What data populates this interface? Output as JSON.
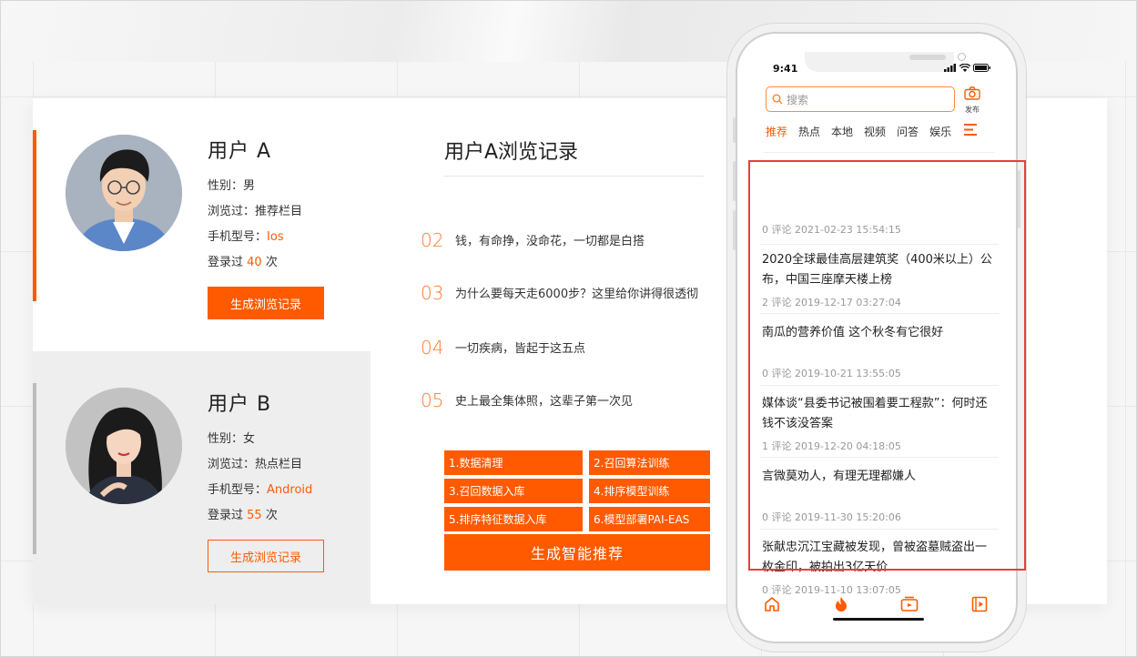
{
  "colors": {
    "accent": "#ff5a00",
    "highlight": "#e0433b",
    "muted": "#999999"
  },
  "users": [
    {
      "name": "用户 A",
      "gender_label": "性别：",
      "gender": "男",
      "browsed_label": "浏览过：",
      "browsed": "推荐栏目",
      "phone_label": "手机型号：",
      "phone": "Ios",
      "login_prefix": "登录过",
      "login_count": "40",
      "login_suffix": "次",
      "button": "生成浏览记录"
    },
    {
      "name": "用户 B",
      "gender_label": "性别：",
      "gender": "女",
      "browsed_label": "浏览过：",
      "browsed": "热点栏目",
      "phone_label": "手机型号：",
      "phone": "Android",
      "login_prefix": "登录过",
      "login_count": "55",
      "login_suffix": "次",
      "button": "生成浏览记录"
    }
  ],
  "history": {
    "title": "用户A浏览记录",
    "items": [
      {
        "num": "02",
        "text": "钱，有命挣，没命花，一切都是白搭"
      },
      {
        "num": "03",
        "text": "为什么要每天走6000步？这里给你讲得很透彻"
      },
      {
        "num": "04",
        "text": "一切疾病，皆起于这五点"
      },
      {
        "num": "05",
        "text": "史上最全集体照，这辈子第一次见"
      }
    ]
  },
  "steps": [
    "1.数据清理",
    "2.召回算法训练",
    "3.召回数据入库",
    "4.排序模型训练",
    "5.排序特征数据入库",
    "6.模型部署PAI-EAS"
  ],
  "smart_button": "生成智能推荐",
  "phone": {
    "time": "9:41",
    "search_placeholder": "搜索",
    "publish_label": "发布",
    "tabs": [
      "推荐",
      "热点",
      "本地",
      "视频",
      "问答",
      "娱乐"
    ],
    "feed": [
      {
        "title": "",
        "meta": "0 评论  2021-02-23 15:54:15"
      },
      {
        "title": "2020全球最佳高层建筑奖（400米以上）公布，中国三座摩天楼上榜",
        "meta": "2 评论  2019-12-17 03:27:04"
      },
      {
        "title": "南瓜的营养价值 这个秋冬有它很好",
        "meta": "0 评论  2019-10-21 13:55:05"
      },
      {
        "title": "媒体谈“县委书记被围着要工程款”：何时还钱不该没答案",
        "meta": "1 评论  2019-12-20 04:18:05"
      },
      {
        "title": "言微莫劝人，有理无理都嫌人",
        "meta": "0 评论  2019-11-30 15:20:06"
      },
      {
        "title": "张献忠沉江宝藏被发现，曾被盗墓贼盗出一枚金印，被拍出3亿天价",
        "meta": "0 评论  2019-11-10 13:07:05"
      }
    ],
    "nav_icons": [
      "home-icon",
      "hot-icon",
      "video-icon",
      "movie-icon"
    ]
  }
}
